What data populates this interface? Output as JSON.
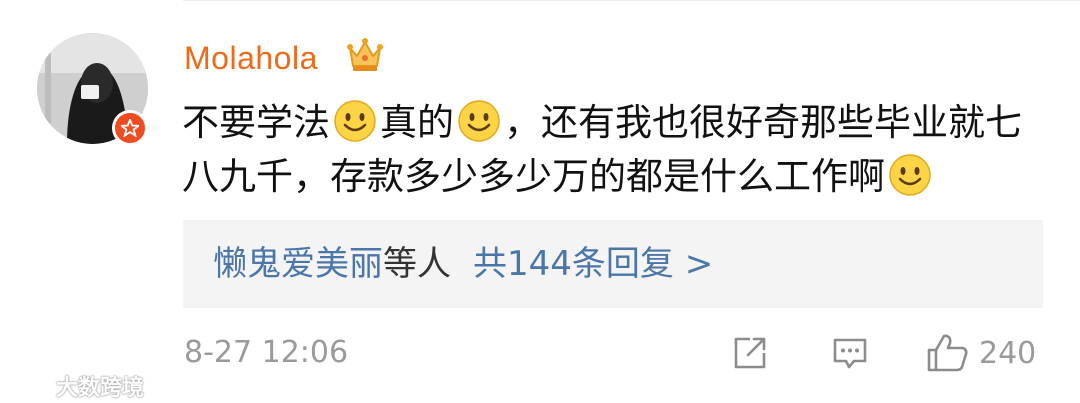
{
  "comment": {
    "username": "Molahola",
    "text_parts": [
      "不要学法",
      "真的",
      "，还有我也很好奇那些毕业就七八九千，存款多少多少万的都是什么工作啊"
    ],
    "emoji": "smile-emoji"
  },
  "replies": {
    "users": "懒鬼爱美丽",
    "etc": "等人",
    "total": "共144条回复 >"
  },
  "footer": {
    "timestamp": "8-27 12:06",
    "like_count": "240"
  },
  "watermark": {
    "text": "大数跨境"
  },
  "colors": {
    "username": "#ee6b19",
    "link": "#4a76a8",
    "badge": "#f14b22",
    "meta": "#9a9a9a"
  }
}
